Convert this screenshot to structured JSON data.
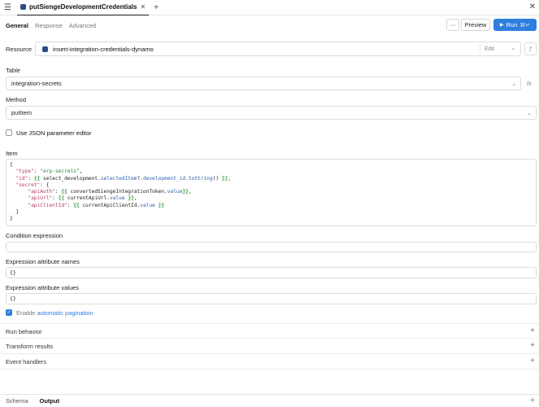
{
  "tab": {
    "title": "putSiengeDevelopmentCredentials"
  },
  "subtabs": [
    "General",
    "Response",
    "Advanced"
  ],
  "toolbar": {
    "more": "···",
    "preview": "Preview",
    "run": "Run",
    "run_shortcut": "⌘↵"
  },
  "resource": {
    "label": "Resource",
    "value": "insert-integration-credentials-dynamo",
    "edit": "Edit"
  },
  "table": {
    "label": "Table",
    "value": "integration-secrets"
  },
  "method": {
    "label": "Method",
    "value": "putItem"
  },
  "json_editor": {
    "label": "Use JSON parameter editor",
    "checked": false
  },
  "item": {
    "label": "Item"
  },
  "condition": {
    "label": "Condition expression",
    "value": ""
  },
  "expr_names": {
    "label": "Expression attribute names",
    "value": "{}"
  },
  "expr_values": {
    "label": "Expression attribute values",
    "value": "{}"
  },
  "pagination": {
    "prefix": "Enable",
    "link": "automatic pagination",
    "checked": true
  },
  "sections": [
    "Run behavior",
    "Transform results",
    "Event handlers"
  ],
  "bottom_tabs": [
    "Schema",
    "Output"
  ],
  "colors": {
    "accent": "#2e7fe0",
    "dynamo": "#2c4a8a"
  }
}
